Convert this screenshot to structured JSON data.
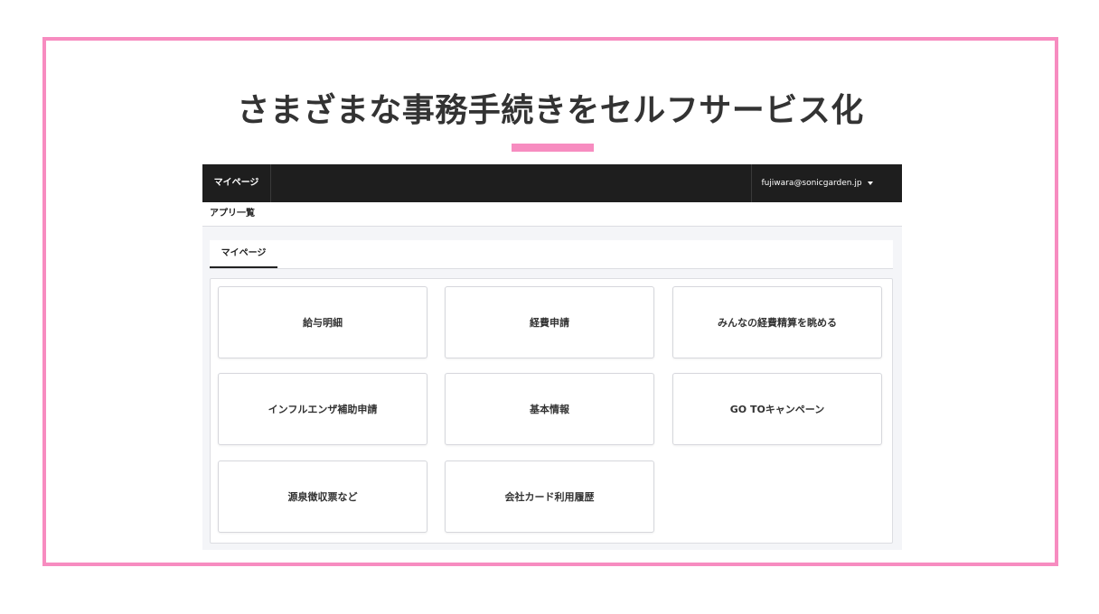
{
  "slide": {
    "title": "さまざまな事務手続きをセルフサービス化",
    "accent_color": "#f78cc0"
  },
  "navbar": {
    "home_label": "マイページ",
    "user_email": "fujiwara@sonicgarden.jp",
    "user_menu_icon": "caret-down-icon",
    "background": "#1e1e1e"
  },
  "subheader": {
    "title": "アプリ一覧"
  },
  "tabs": [
    {
      "label": "マイページ",
      "active": true
    }
  ],
  "apps": [
    {
      "label": "給与明細"
    },
    {
      "label": "経費申請"
    },
    {
      "label": "みんなの経費精算を眺める"
    },
    {
      "label": "インフルエンザ補助申請"
    },
    {
      "label": "基本情報"
    },
    {
      "label": "GO TOキャンペーン"
    },
    {
      "label": "源泉徴収票など"
    },
    {
      "label": "会社カード利用履歴"
    }
  ]
}
